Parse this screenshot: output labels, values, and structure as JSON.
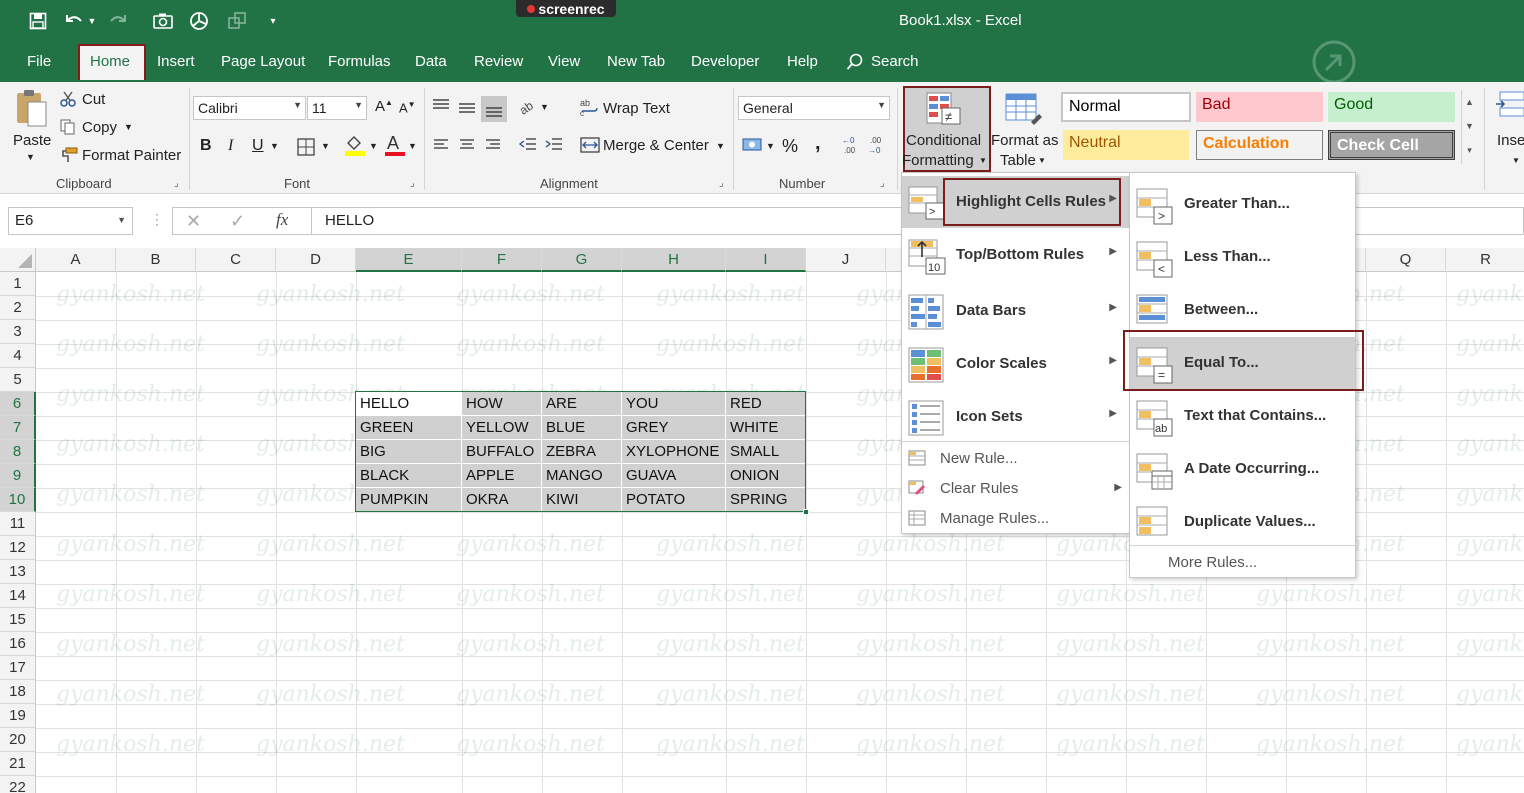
{
  "window": {
    "title": "Book1.xlsx - Excel",
    "recorder_logo": "screenrec"
  },
  "tabs": [
    "File",
    "Home",
    "Insert",
    "Page Layout",
    "Formulas",
    "Data",
    "Review",
    "View",
    "New Tab",
    "Developer",
    "Help"
  ],
  "search_label": "Search",
  "clipboard": {
    "paste": "Paste",
    "cut": "Cut",
    "copy": "Copy",
    "format_painter": "Format Painter",
    "group": "Clipboard"
  },
  "font": {
    "name": "Calibri",
    "size": "11",
    "group": "Font"
  },
  "alignment": {
    "wrap": "Wrap Text",
    "merge": "Merge & Center",
    "group": "Alignment"
  },
  "number": {
    "format": "General",
    "percent": "%",
    "comma": ",",
    "group": "Number"
  },
  "styles_group": {
    "conditional_1": "Conditional",
    "conditional_2": "Formatting",
    "format_1": "Format as",
    "format_2": "Table",
    "insert": "Inse",
    "cells": [
      {
        "label": "Normal",
        "bg": "#ffffff",
        "fg": "#000000"
      },
      {
        "label": "Bad",
        "bg": "#ffc7ce",
        "fg": "#9c0006"
      },
      {
        "label": "Good",
        "bg": "#c6efce",
        "fg": "#006100"
      },
      {
        "label": "Neutral",
        "bg": "#ffeb9c",
        "fg": "#9c5700"
      },
      {
        "label": "Calculation",
        "bg": "#f2f2f2",
        "fg": "#fa7d00"
      },
      {
        "label": "Check Cell",
        "bg": "#a5a5a5",
        "fg": "#ffffff"
      }
    ]
  },
  "formula_bar": {
    "name_box": "E6",
    "fx": "fx",
    "value": "HELLO"
  },
  "columns": [
    "A",
    "B",
    "C",
    "D",
    "E",
    "F",
    "G",
    "H",
    "I",
    "J",
    "Q",
    "R"
  ],
  "rows": [
    "1",
    "2",
    "3",
    "4",
    "5",
    "6",
    "7",
    "8",
    "9",
    "10",
    "11",
    "12",
    "13",
    "14",
    "15",
    "16",
    "17",
    "18",
    "19",
    "20",
    "21",
    "22"
  ],
  "table": [
    [
      "HELLO",
      "HOW",
      "ARE",
      "YOU",
      "RED"
    ],
    [
      "GREEN",
      "YELLOW",
      "BLUE",
      "GREY",
      "WHITE"
    ],
    [
      "BIG",
      "BUFFALO",
      "ZEBRA",
      "XYLOPHONE",
      "SMALL"
    ],
    [
      "BLACK",
      "APPLE",
      "MANGO",
      "GUAVA",
      "ONION"
    ],
    [
      "PUMPKIN",
      "OKRA",
      "KIWI",
      "POTATO",
      "SPRING"
    ]
  ],
  "watermark": "gyankosh.net",
  "cf_menu": {
    "items": [
      "Highlight Cells Rules",
      "Top/Bottom Rules",
      "Data Bars",
      "Color Scales",
      "Icon Sets"
    ],
    "small": [
      "New Rule...",
      "Clear Rules",
      "Manage Rules..."
    ]
  },
  "submenu": {
    "items": [
      "Greater Than...",
      "Less Than...",
      "Between...",
      "Equal To...",
      "Text that Contains...",
      "A Date Occurring...",
      "Duplicate Values..."
    ],
    "more": "More Rules..."
  },
  "icon_text": {
    "top_num": "10",
    "text_ab": "ab"
  }
}
